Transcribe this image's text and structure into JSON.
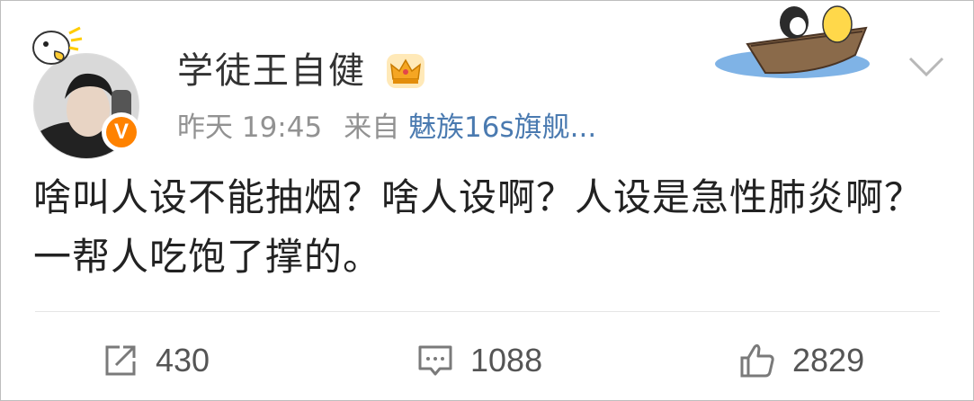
{
  "post": {
    "username": "学徒王自健",
    "verified_badge": "V",
    "time": "昨天 19:45",
    "source_prefix": "来自",
    "source": "魅族16s旗舰...",
    "content": "啥叫人设不能抽烟？啥人设啊？人设是急性肺炎啊？一帮人吃饱了撑的。"
  },
  "actions": {
    "repost_count": "430",
    "comment_count": "1088",
    "like_count": "2829"
  },
  "icons": {
    "crown": "crown-icon",
    "boat": "boat-decoration-icon",
    "menu": "chevron-down-icon",
    "repost": "share-icon",
    "comment": "comment-icon",
    "like": "thumbs-up-icon"
  },
  "colors": {
    "verified": "#ff8200",
    "source_link": "#4a7ab0",
    "meta_text": "#929292"
  }
}
